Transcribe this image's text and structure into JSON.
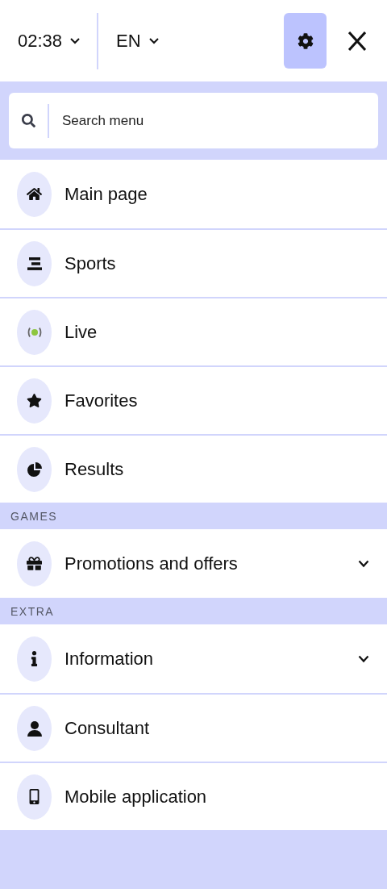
{
  "header": {
    "time": "02:38",
    "language": "EN"
  },
  "search": {
    "placeholder": "Search menu"
  },
  "sections": [
    {
      "items": [
        {
          "label": "Main page",
          "kind": "link"
        },
        {
          "label": "Sports",
          "kind": "link"
        },
        {
          "label": "Live",
          "kind": "link"
        },
        {
          "label": "Favorites",
          "kind": "link"
        },
        {
          "label": "Results",
          "kind": "link"
        }
      ]
    },
    {
      "title": "GAMES",
      "items": [
        {
          "label": "Promotions and offers",
          "kind": "group",
          "expanded": false
        }
      ]
    },
    {
      "title": "EXTRA",
      "items": [
        {
          "label": "Information",
          "kind": "group",
          "expanded": false
        },
        {
          "label": "Consultant",
          "kind": "link"
        },
        {
          "label": "Mobile application",
          "kind": "link"
        }
      ]
    }
  ]
}
